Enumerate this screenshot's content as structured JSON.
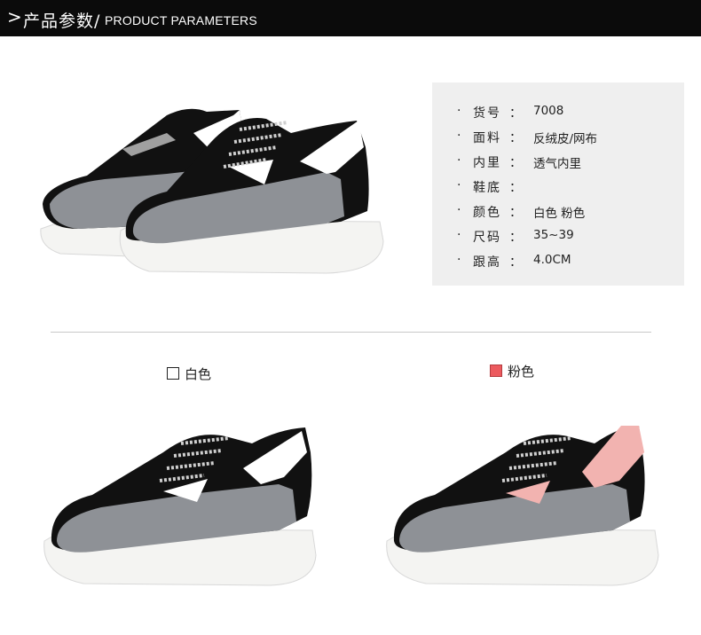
{
  "header": {
    "arrow": ">",
    "title_cn": "产品参数/",
    "title_en": "PRODUCT PARAMETERS"
  },
  "params": [
    {
      "key": "货号",
      "value": "7008"
    },
    {
      "key": "面料",
      "value": "反绒皮/网布"
    },
    {
      "key": "内里",
      "value": "透气内里"
    },
    {
      "key": "鞋底",
      "value": ""
    },
    {
      "key": "颜色",
      "value": "白色  粉色"
    },
    {
      "key": "尺码",
      "value": "35~39"
    },
    {
      "key": "跟高",
      "value": "4.0CM"
    }
  ],
  "bullet": "·",
  "colon": "：",
  "variants": [
    {
      "label": "白色",
      "swatch_color": "#ffffff",
      "accent_color": "#ffffff"
    },
    {
      "label": "粉色",
      "swatch_color": "#ec5a5e",
      "accent_color": "#f2b3b0"
    }
  ],
  "colors": {
    "mesh": "#8e9196",
    "suede": "#111111",
    "sole": "#f4f4f2",
    "header_bg": "#0b0b0b"
  }
}
